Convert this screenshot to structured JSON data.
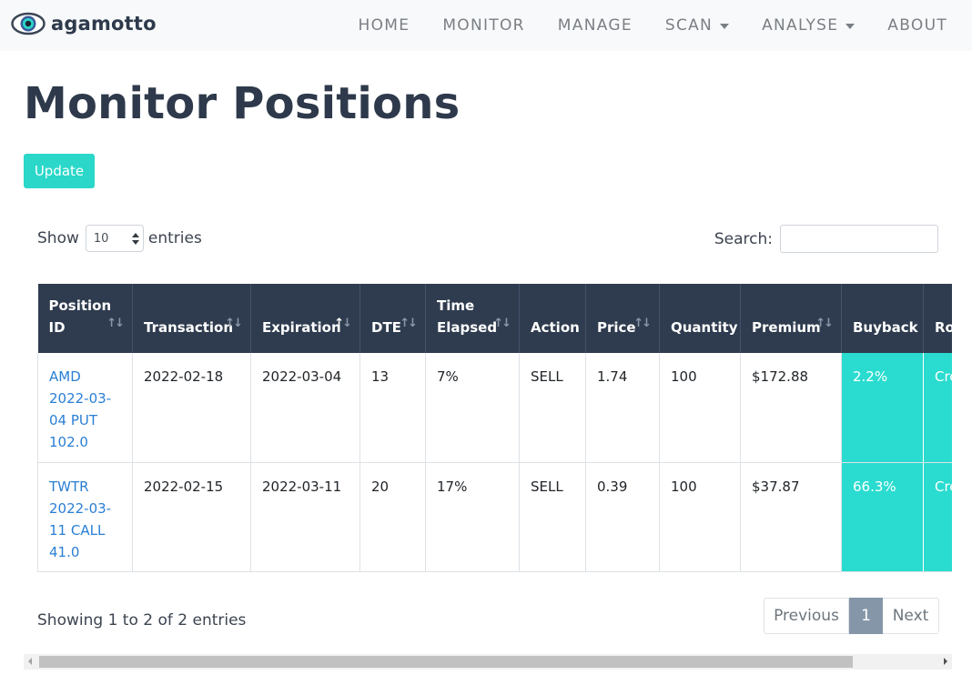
{
  "brand": {
    "name": "agamotto",
    "icon": "eye-icon"
  },
  "nav": {
    "items": [
      {
        "label": "HOME",
        "dropdown": false
      },
      {
        "label": "MONITOR",
        "dropdown": false
      },
      {
        "label": "MANAGE",
        "dropdown": false
      },
      {
        "label": "SCAN",
        "dropdown": true
      },
      {
        "label": "ANALYSE",
        "dropdown": true
      },
      {
        "label": "ABOUT",
        "dropdown": false
      }
    ]
  },
  "page": {
    "title": "Monitor Positions",
    "update_label": "Update"
  },
  "length": {
    "prefix": "Show",
    "value": "10",
    "suffix": "entries"
  },
  "search": {
    "label": "Search:",
    "value": ""
  },
  "table": {
    "headers": [
      "Position ID",
      "Transaction",
      "Expiration",
      "DTE",
      "Time Elapsed",
      "Action",
      "Price",
      "Quantity",
      "Premium",
      "Buyback",
      "Ro"
    ],
    "rows": [
      {
        "position_id": "AMD 2022-03-04 PUT 102.0",
        "transaction": "2022-02-18",
        "expiration": "2022-03-04",
        "dte": "13",
        "time_elapsed": "7%",
        "action": "SELL",
        "price": "1.74",
        "quantity": "100",
        "premium": "$172.88",
        "buyback": "2.2%",
        "roll": "Cre"
      },
      {
        "position_id": "TWTR 2022-03-11 CALL 41.0",
        "transaction": "2022-02-15",
        "expiration": "2022-03-11",
        "dte": "20",
        "time_elapsed": "17%",
        "action": "SELL",
        "price": "0.39",
        "quantity": "100",
        "premium": "$37.87",
        "buyback": "66.3%",
        "roll": "Cre"
      }
    ]
  },
  "info": "Showing 1 to 2 of 2 entries",
  "pager": {
    "previous": "Previous",
    "current": "1",
    "next": "Next"
  },
  "colors": {
    "accent": "#2ad7c9",
    "header_bg": "#2f3c4f",
    "link": "#2a7fd4"
  }
}
